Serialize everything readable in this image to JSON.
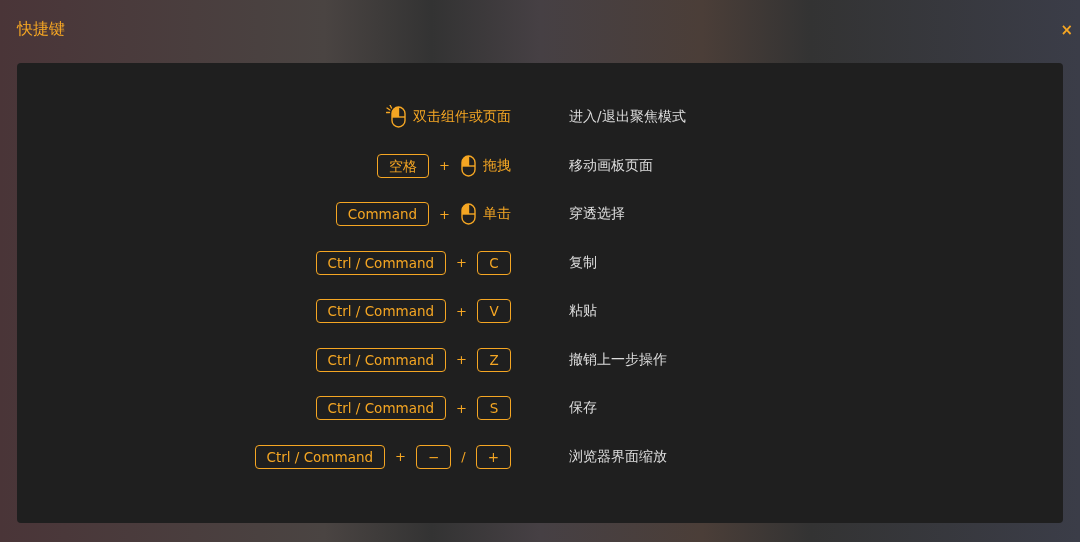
{
  "dialog": {
    "title": "快捷键",
    "close": "×"
  },
  "shortcuts": [
    {
      "keys": [
        {
          "kind": "dblclick",
          "text": "双击组件或页面"
        }
      ],
      "action": "进入/退出聚焦模式"
    },
    {
      "keys": [
        {
          "kind": "key",
          "text": "空格"
        },
        {
          "kind": "plus",
          "text": "+"
        },
        {
          "kind": "click",
          "text": "拖拽"
        }
      ],
      "action": "移动画板页面"
    },
    {
      "keys": [
        {
          "kind": "key",
          "text": "Command"
        },
        {
          "kind": "plus",
          "text": "+"
        },
        {
          "kind": "click",
          "text": "单击"
        }
      ],
      "action": "穿透选择"
    },
    {
      "keys": [
        {
          "kind": "key",
          "text": "Ctrl / Command"
        },
        {
          "kind": "plus",
          "text": "+"
        },
        {
          "kind": "key",
          "text": "C"
        }
      ],
      "action": "复制"
    },
    {
      "keys": [
        {
          "kind": "key",
          "text": "Ctrl / Command"
        },
        {
          "kind": "plus",
          "text": "+"
        },
        {
          "kind": "key",
          "text": "V"
        }
      ],
      "action": "粘贴"
    },
    {
      "keys": [
        {
          "kind": "key",
          "text": "Ctrl / Command"
        },
        {
          "kind": "plus",
          "text": "+"
        },
        {
          "kind": "key",
          "text": "Z"
        }
      ],
      "action": "撤销上一步操作"
    },
    {
      "keys": [
        {
          "kind": "key",
          "text": "Ctrl / Command"
        },
        {
          "kind": "plus",
          "text": "+"
        },
        {
          "kind": "key",
          "text": "S"
        }
      ],
      "action": "保存"
    },
    {
      "keys": [
        {
          "kind": "key",
          "text": "Ctrl / Command"
        },
        {
          "kind": "plus",
          "text": "+"
        },
        {
          "kind": "key",
          "text": "−"
        },
        {
          "kind": "slash",
          "text": "/"
        },
        {
          "kind": "key",
          "text": "+"
        }
      ],
      "action": "浏览器界面缩放"
    }
  ]
}
